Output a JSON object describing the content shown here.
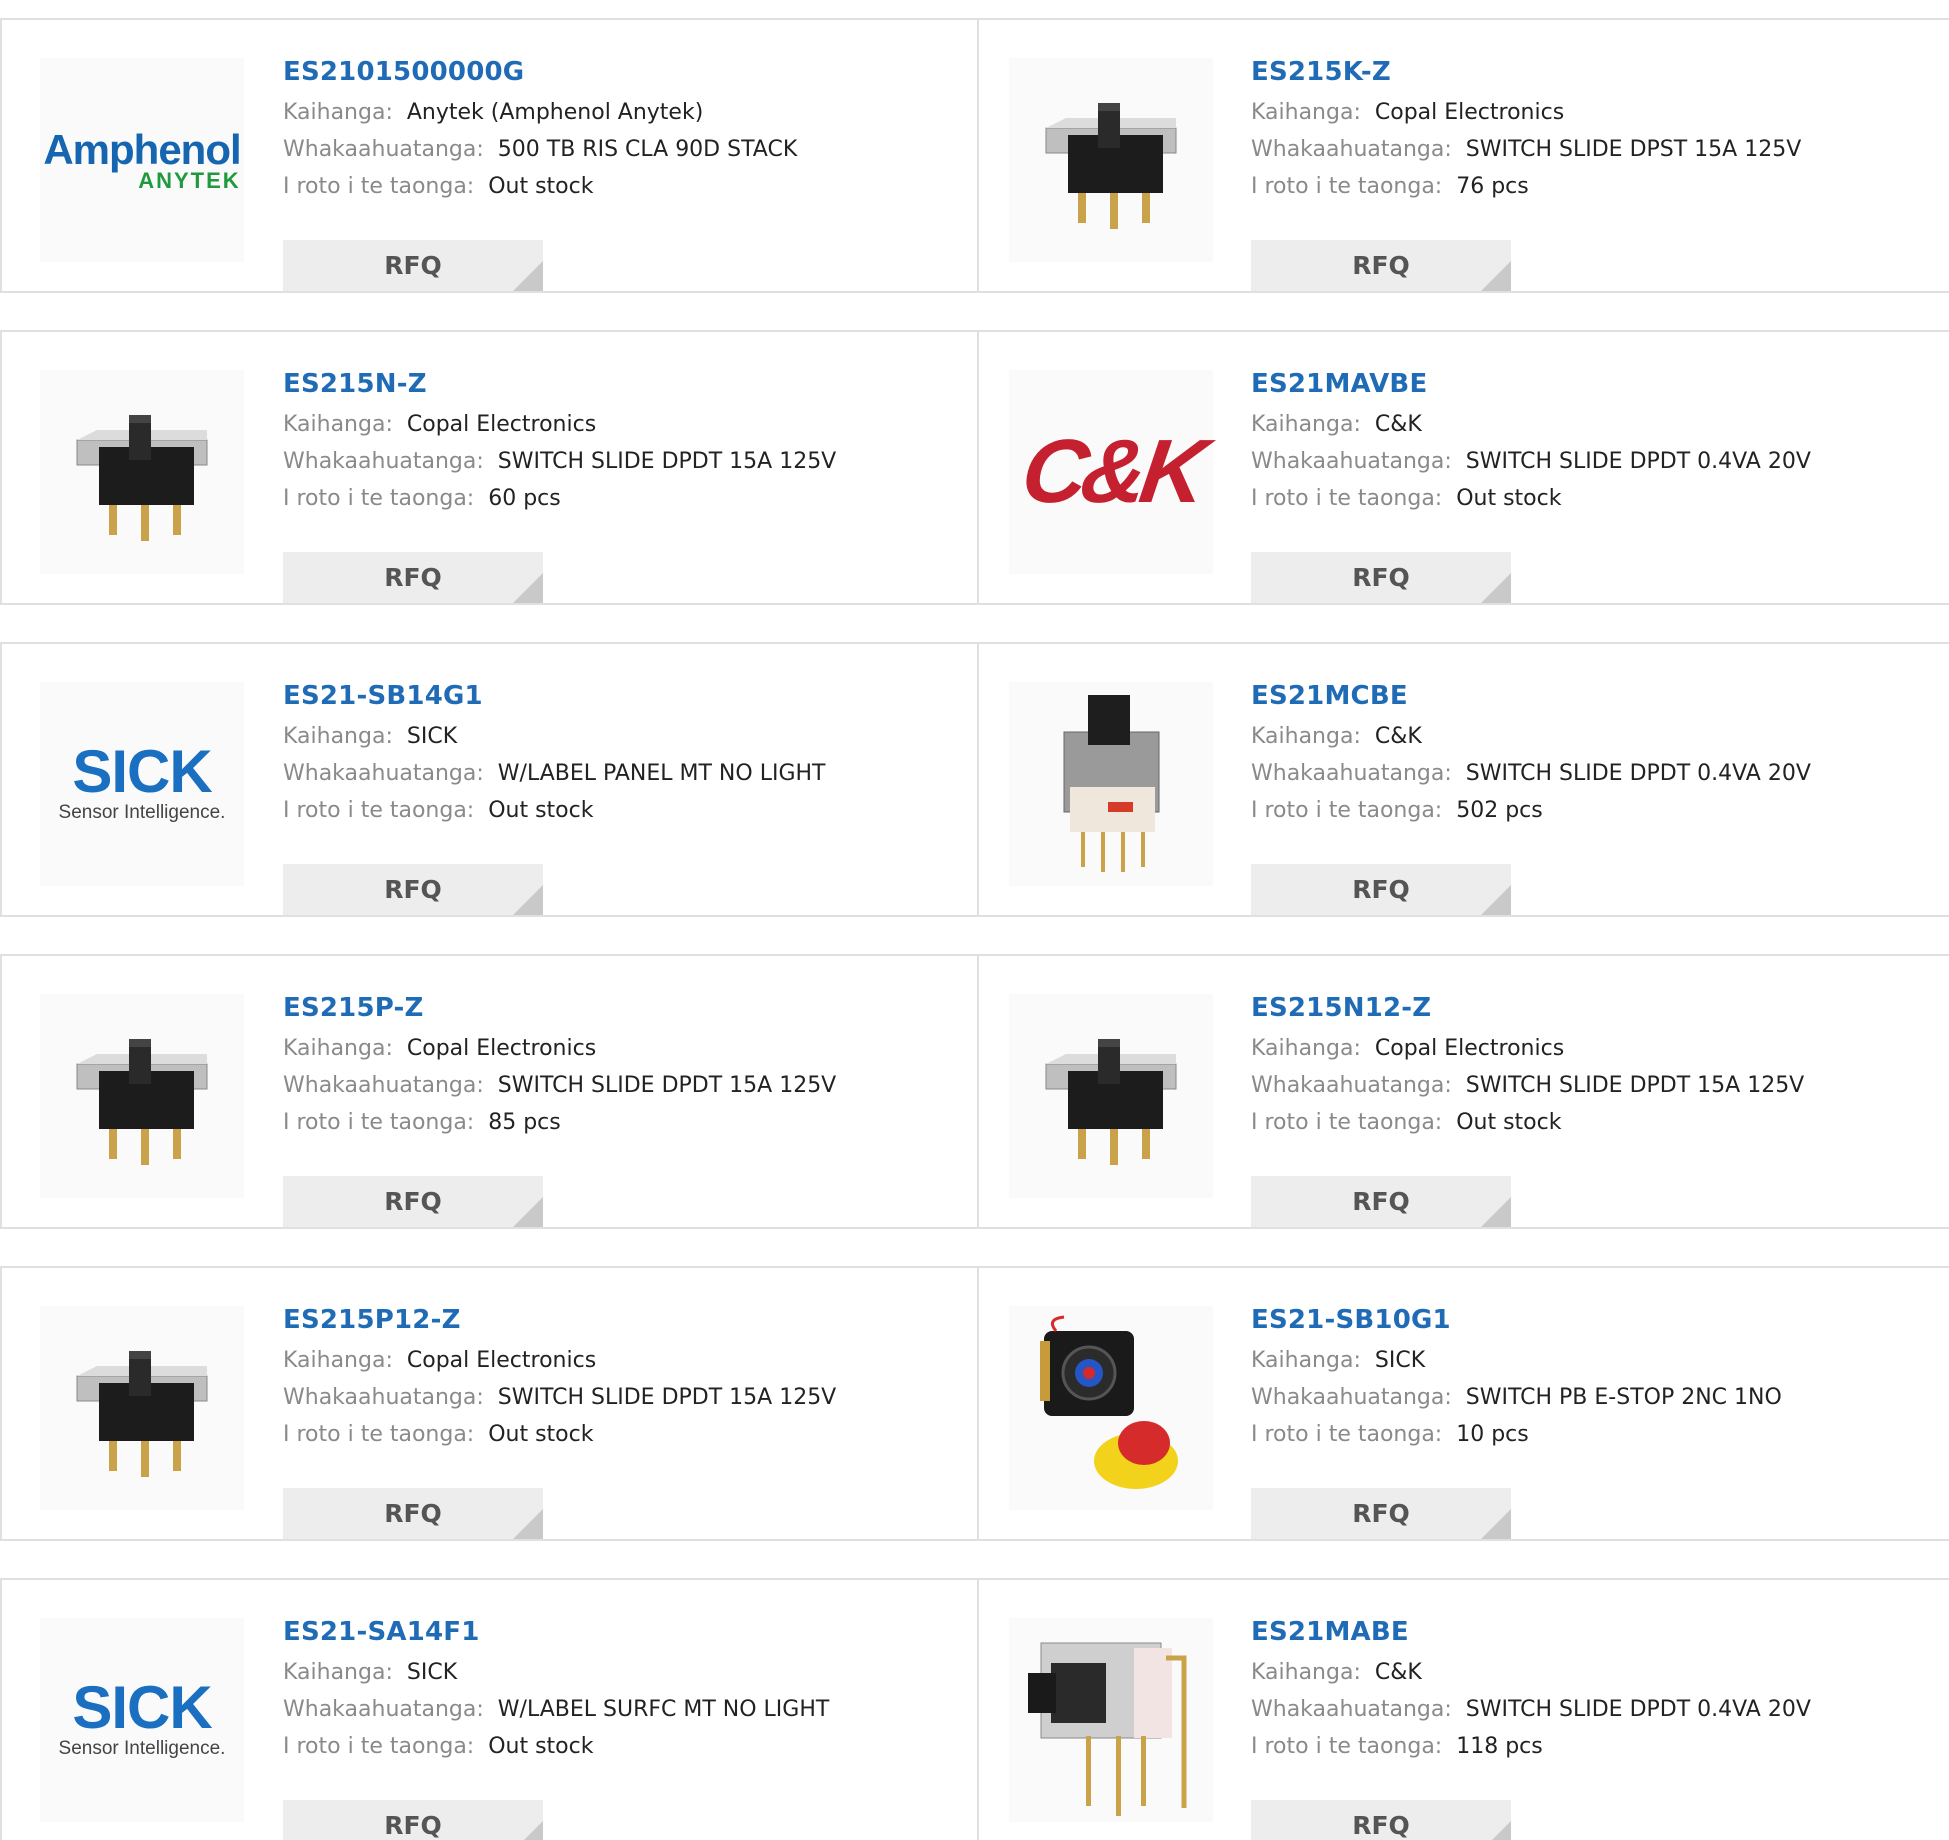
{
  "labels": {
    "manufacturer": "Kaihanga:",
    "description": "Whakaahuatanga:",
    "stock": "I roto i te taonga:",
    "rfq": "RFQ"
  },
  "products": [
    {
      "part": "ES2101500000G",
      "manufacturer": "Anytek (Amphenol Anytek)",
      "description": "500 TB RIS CLA 90D STACK",
      "stock": "Out stock",
      "image": "amphenol-logo"
    },
    {
      "part": "ES215K-Z",
      "manufacturer": "Copal Electronics",
      "description": "SWITCH SLIDE DPST 15A 125V",
      "stock": "76 pcs",
      "image": "slide-switch"
    },
    {
      "part": "ES215N-Z",
      "manufacturer": "Copal Electronics",
      "description": "SWITCH SLIDE DPDT 15A 125V",
      "stock": "60 pcs",
      "image": "slide-switch"
    },
    {
      "part": "ES21MAVBE",
      "manufacturer": "C&K",
      "description": "SWITCH SLIDE DPDT 0.4VA 20V",
      "stock": "Out stock",
      "image": "ck-logo"
    },
    {
      "part": "ES21-SB14G1",
      "manufacturer": "SICK",
      "description": "W/LABEL PANEL MT NO LIGHT",
      "stock": "Out stock",
      "image": "sick-logo"
    },
    {
      "part": "ES21MCBE",
      "manufacturer": "C&K",
      "description": "SWITCH SLIDE DPDT 0.4VA 20V",
      "stock": "502 pcs",
      "image": "mini-slide-switch"
    },
    {
      "part": "ES215P-Z",
      "manufacturer": "Copal Electronics",
      "description": "SWITCH SLIDE DPDT 15A 125V",
      "stock": "85 pcs",
      "image": "slide-switch"
    },
    {
      "part": "ES215N12-Z",
      "manufacturer": "Copal Electronics",
      "description": "SWITCH SLIDE DPDT 15A 125V",
      "stock": "Out stock",
      "image": "slide-switch"
    },
    {
      "part": "ES215P12-Z",
      "manufacturer": "Copal Electronics",
      "description": "SWITCH SLIDE DPDT 15A 125V",
      "stock": "Out stock",
      "image": "slide-switch"
    },
    {
      "part": "ES21-SB10G1",
      "manufacturer": "SICK",
      "description": "SWITCH PB E-STOP 2NC 1NO",
      "stock": "10 pcs",
      "image": "estop-switch"
    },
    {
      "part": "ES21-SA14F1",
      "manufacturer": "SICK",
      "description": "W/LABEL SURFC MT NO LIGHT",
      "stock": "Out stock",
      "image": "sick-logo"
    },
    {
      "part": "ES21MABE",
      "manufacturer": "C&K",
      "description": "SWITCH SLIDE DPDT 0.4VA 20V",
      "stock": "118 pcs",
      "image": "right-angle-switch"
    }
  ],
  "logos": {
    "amphenol": {
      "line1": "Amphenol",
      "line2": "ANYTEK"
    },
    "sick": {
      "line1": "SICK",
      "line2": "Sensor Intelligence."
    },
    "ck": {
      "text": "C&K"
    }
  },
  "colors": {
    "part_link": "#1f6bb5",
    "label": "#8a8a8a",
    "value": "#222222",
    "rfq_bg": "#ededed"
  }
}
